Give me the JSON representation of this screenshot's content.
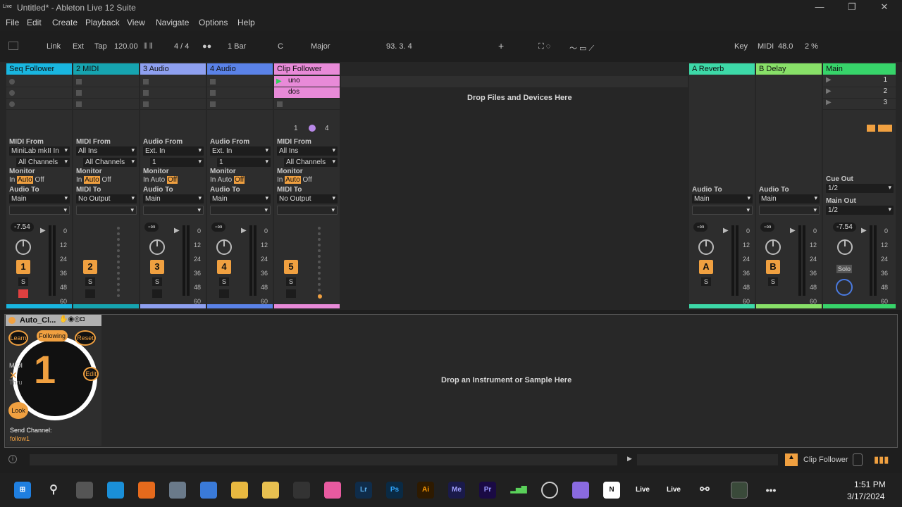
{
  "window": {
    "title": "Untitled* - Ableton Live 12 Suite",
    "logo": "Live"
  },
  "menu": [
    "File",
    "Edit",
    "Create",
    "Playback",
    "View",
    "Navigate",
    "Options",
    "Help"
  ],
  "control": {
    "link": "Link",
    "ext": "Ext",
    "tap": "Tap",
    "tempo": "120.00",
    "sig": "4 / 4",
    "quant": "1 Bar",
    "key": "C",
    "scale": "Major",
    "position": "93.  3.  4",
    "key_btn": "Key",
    "midi_btn": "MIDI",
    "zoom": "48.0",
    "cpu": "2 %"
  },
  "tracks": [
    {
      "name": "Seq Follower",
      "color": "#19b6e0",
      "io": "MIDI From",
      "from": "MiniLab mkII In",
      "ch": "All Channels",
      "to_label": "Audio To",
      "to": "Main",
      "vol": "-7.54",
      "num": "1"
    },
    {
      "name": "2 MIDI",
      "color": "#16a4b0",
      "io": "MIDI From",
      "from": "All Ins",
      "ch": "All Channels",
      "to_label": "MIDI To",
      "to": "No Output",
      "vol": "",
      "num": "2"
    },
    {
      "name": "3 Audio",
      "color": "#8ea0f0",
      "io": "Audio From",
      "from": "Ext. In",
      "ch": "1",
      "to_label": "Audio To",
      "to": "Main",
      "vol": "-∞",
      "num": "3"
    },
    {
      "name": "4 Audio",
      "color": "#5a82e8",
      "io": "Audio From",
      "from": "Ext. In",
      "ch": "1",
      "to_label": "Audio To",
      "to": "Main",
      "vol": "-∞",
      "num": "4"
    },
    {
      "name": "Clip Follower",
      "color": "#e88ad8",
      "io": "MIDI From",
      "from": "All Ins",
      "ch": "All Channels",
      "to_label": "MIDI To",
      "to": "No Output",
      "vol": "",
      "num": "5"
    }
  ],
  "clips": {
    "uno": "uno",
    "dos": "dos",
    "follower_a": "1",
    "follower_b": "4"
  },
  "monitor": {
    "label": "Monitor",
    "in": "In",
    "auto": "Auto",
    "off": "Off"
  },
  "scale_vals": [
    "0",
    "12",
    "24",
    "36",
    "48",
    "60"
  ],
  "solo": "S",
  "drop_files": "Drop Files and Devices Here",
  "returns": [
    {
      "name": "A Reverb",
      "color": "#3dd9a8",
      "to": "Main",
      "vol": "-∞",
      "letter": "A"
    },
    {
      "name": "B Delay",
      "color": "#88e068",
      "to": "Main",
      "vol": "-∞",
      "letter": "B"
    }
  ],
  "main": {
    "name": "Main",
    "color": "#37d46a",
    "scenes": [
      "1",
      "2",
      "3"
    ],
    "cue_label": "Cue Out",
    "cue": "1/2",
    "out_label": "Main Out",
    "out": "1/2",
    "vol": "-7.54",
    "solo": "Solo"
  },
  "audio_to_label": "Audio To",
  "device": {
    "title": "Auto_Cl...",
    "learn": "Learn",
    "following": "Following",
    "reset": "Reset",
    "midi": "MIDI",
    "thru": "Thru",
    "edit": "Edit",
    "look": "Look",
    "send": "Send Channel:",
    "channel": "follow1",
    "big": "1"
  },
  "drop_instrument": "Drop an Instrument or Sample Here",
  "status": {
    "clip": "Clip Follower"
  },
  "taskbar": {
    "time": "1:51 PM",
    "date": "3/17/2024",
    "apps": [
      "Lr",
      "Ps",
      "Ai",
      "Me",
      "Pr",
      "Live",
      "Live"
    ]
  }
}
